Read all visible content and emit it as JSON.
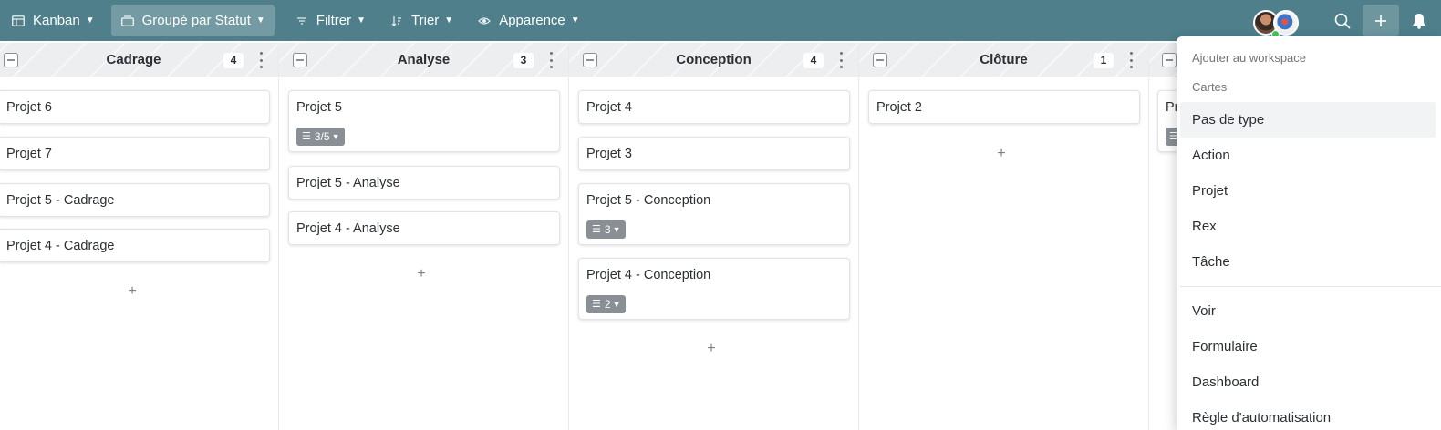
{
  "toolbar": {
    "view_label": "Kanban",
    "group_label": "Groupé par Statut",
    "filter_label": "Filtrer",
    "sort_label": "Trier",
    "appearance_label": "Apparence"
  },
  "columns": [
    {
      "title": "Cadrage",
      "count": "4",
      "cards": [
        {
          "title": "Projet 6"
        },
        {
          "title": "Projet 7"
        },
        {
          "title": "Projet 5 - Cadrage"
        },
        {
          "title": "Projet 4 - Cadrage"
        }
      ]
    },
    {
      "title": "Analyse",
      "count": "3",
      "cards": [
        {
          "title": "Projet 5",
          "subtasks": "3/5"
        },
        {
          "title": "Projet 5 - Analyse"
        },
        {
          "title": "Projet 4 - Analyse"
        }
      ]
    },
    {
      "title": "Conception",
      "count": "4",
      "cards": [
        {
          "title": "Projet 4"
        },
        {
          "title": "Projet 3"
        },
        {
          "title": "Projet 5 - Conception",
          "subtasks": "3"
        },
        {
          "title": "Projet 4 - Conception",
          "subtasks": "2"
        }
      ]
    },
    {
      "title": "Clôture",
      "count": "1",
      "cards": [
        {
          "title": "Projet 2"
        }
      ]
    },
    {
      "title": "",
      "count": "",
      "cards": [
        {
          "title": "Pr"
        }
      ]
    }
  ],
  "add_symbol": "+",
  "dropdown": {
    "section_workspace": "Ajouter au workspace",
    "section_cards": "Cartes",
    "card_items": [
      "Pas de type",
      "Action",
      "Projet",
      "Rex",
      "Tâche"
    ],
    "other_items": [
      "Voir",
      "Formulaire",
      "Dashboard",
      "Règle d'automatisation"
    ]
  },
  "colors": {
    "toolbar_bg": "#4e7f8a",
    "badge_bg": "#8a8f96",
    "online": "#4cc35a"
  }
}
